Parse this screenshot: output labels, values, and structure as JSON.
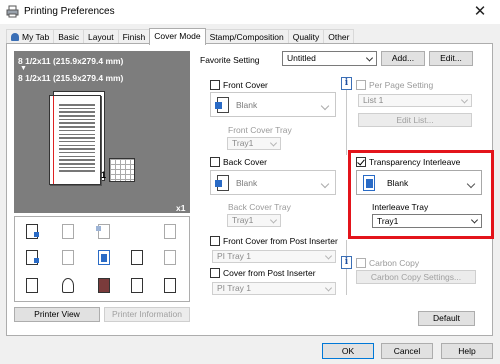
{
  "window": {
    "title": "Printing Preferences",
    "close_glyph": "✕"
  },
  "tabs": [
    {
      "label": "My Tab",
      "active": false
    },
    {
      "label": "Basic",
      "active": false
    },
    {
      "label": "Layout",
      "active": false
    },
    {
      "label": "Finish",
      "active": false
    },
    {
      "label": "Cover Mode",
      "active": true
    },
    {
      "label": "Stamp/Composition",
      "active": false
    },
    {
      "label": "Quality",
      "active": false
    },
    {
      "label": "Other",
      "active": false
    }
  ],
  "preview": {
    "paper_line_1": "8 1/2x11 (215.9x279.4 mm)",
    "arrow": "▼",
    "paper_line_2": "8 1/2x11 (215.9x279.4 mm)",
    "copies": "x1",
    "page_number": "1"
  },
  "favorite": {
    "label": "Favorite Setting",
    "value": "Untitled",
    "add": "Add...",
    "edit": "Edit..."
  },
  "front_cover": {
    "label": "Front Cover",
    "checked": false,
    "value": "Blank",
    "tray_label": "Front Cover Tray",
    "tray": "Tray1"
  },
  "back_cover": {
    "label": "Back Cover",
    "checked": false,
    "value": "Blank",
    "tray_label": "Back Cover Tray",
    "tray": "Tray1"
  },
  "front_post": {
    "label": "Front Cover from Post Inserter",
    "checked": false,
    "tray": "PI Tray 1"
  },
  "back_post": {
    "label": "Cover from Post Inserter",
    "checked": false,
    "tray": "PI Tray 1"
  },
  "per_page": {
    "label": "Per Page Setting",
    "checked": false,
    "list": "List 1",
    "edit": "Edit List..."
  },
  "transparency": {
    "label": "Transparency Interleave",
    "checked": true,
    "value": "Blank",
    "tray_label": "Interleave Tray",
    "tray": "Tray1"
  },
  "carbon": {
    "label": "Carbon Copy",
    "checked": false,
    "settings": "Carbon Copy Settings..."
  },
  "buttons": {
    "printer_view": "Printer View",
    "printer_information": "Printer Information",
    "default": "Default",
    "ok": "OK",
    "cancel": "Cancel",
    "help": "Help"
  },
  "info_glyph": "i",
  "colors": {
    "highlight": "#e3141b",
    "accent": "#2a6bc6",
    "preview_bg": "#7d7d7d"
  }
}
